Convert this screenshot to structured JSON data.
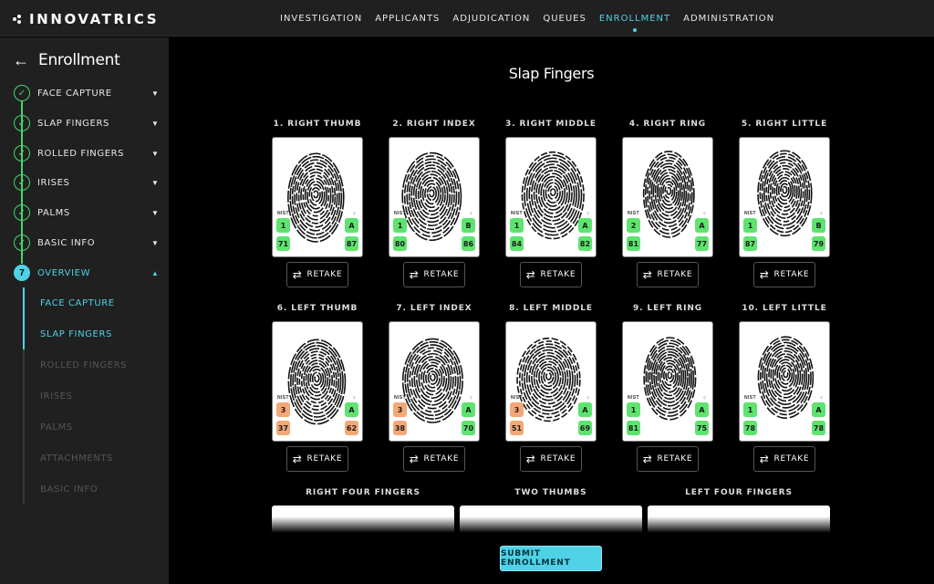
{
  "app": {
    "logo_text": "INNOVATRICS"
  },
  "nav": [
    {
      "label": "INVESTIGATION",
      "active": false
    },
    {
      "label": "APPLICANTS",
      "active": false
    },
    {
      "label": "ADJUDICATION",
      "active": false
    },
    {
      "label": "QUEUES",
      "active": false
    },
    {
      "label": "ENROLLMENT",
      "active": true
    },
    {
      "label": "ADMINISTRATION",
      "active": false
    }
  ],
  "sidebar": {
    "title": "Enrollment",
    "steps": [
      {
        "label": "FACE CAPTURE",
        "state": "done",
        "icon": "check-icon",
        "chevron": "chevron-down-icon"
      },
      {
        "label": "SLAP FINGERS",
        "state": "done",
        "icon": "check-icon",
        "chevron": "chevron-down-icon"
      },
      {
        "label": "ROLLED FINGERS",
        "state": "done",
        "icon": "check-icon",
        "chevron": "chevron-down-icon"
      },
      {
        "label": "IRISES",
        "state": "done",
        "icon": "check-icon",
        "chevron": "chevron-down-icon"
      },
      {
        "label": "PALMS",
        "state": "done",
        "icon": "check-icon",
        "chevron": "chevron-down-icon"
      },
      {
        "label": "BASIC INFO",
        "state": "done",
        "icon": "check-icon",
        "chevron": "chevron-down-icon"
      },
      {
        "label": "OVERVIEW",
        "state": "current",
        "number": "7",
        "chevron": "chevron-up-icon"
      }
    ],
    "overview_items": [
      {
        "label": "FACE CAPTURE",
        "state": "visited"
      },
      {
        "label": "SLAP FINGERS",
        "state": "visited"
      },
      {
        "label": "ROLLED FINGERS",
        "state": "pending"
      },
      {
        "label": "IRISES",
        "state": "pending"
      },
      {
        "label": "PALMS",
        "state": "pending"
      },
      {
        "label": "ATTACHMENTS",
        "state": "pending"
      },
      {
        "label": "BASIC INFO",
        "state": "pending"
      }
    ]
  },
  "main": {
    "title": "Slap Fingers",
    "nist_label": "NIST",
    "retake_label": "RETAKE",
    "fingers": [
      {
        "label": "1. RIGHT THUMB",
        "nist": "1",
        "nist_q": "71",
        "nfiq": "A",
        "score": "87"
      },
      {
        "label": "2. RIGHT INDEX",
        "nist": "1",
        "nist_q": "80",
        "nfiq": "B",
        "score": "86"
      },
      {
        "label": "3. RIGHT MIDDLE",
        "nist": "1",
        "nist_q": "84",
        "nfiq": "A",
        "score": "82"
      },
      {
        "label": "4. RIGHT RING",
        "nist": "2",
        "nist_q": "81",
        "nfiq": "A",
        "score": "77"
      },
      {
        "label": "5. RIGHT LITTLE",
        "nist": "1",
        "nist_q": "87",
        "nfiq": "B",
        "score": "79"
      },
      {
        "label": "6. LEFT THUMB",
        "nist": "3",
        "nist_q": "37",
        "nfiq": "A",
        "score": "62"
      },
      {
        "label": "7. LEFT INDEX",
        "nist": "3",
        "nist_q": "38",
        "nfiq": "A",
        "score": "70"
      },
      {
        "label": "8. LEFT MIDDLE",
        "nist": "3",
        "nist_q": "51",
        "nfiq": "A",
        "score": "69"
      },
      {
        "label": "9. LEFT RING",
        "nist": "1",
        "nist_q": "81",
        "nfiq": "A",
        "score": "75"
      },
      {
        "label": "10. LEFT LITTLE",
        "nist": "1",
        "nist_q": "78",
        "nfiq": "A",
        "score": "78"
      }
    ],
    "slaps": [
      {
        "label": "RIGHT FOUR FINGERS"
      },
      {
        "label": "TWO THUMBS"
      },
      {
        "label": "LEFT FOUR FINGERS"
      }
    ],
    "submit_label": "SUBMIT ENROLLMENT"
  },
  "colors": {
    "accent": "#4fd1e6",
    "good": "#5ee36f",
    "warn": "#f3a875",
    "done": "#47d46c"
  }
}
